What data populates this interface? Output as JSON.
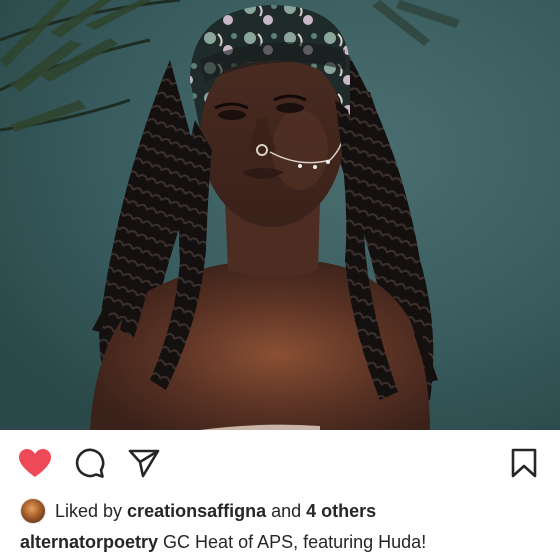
{
  "post": {
    "image_alt": "Portrait of a woman with long braids, patterned head wrap and nose chain against a teal wall"
  },
  "actions": {
    "like_color": "#ed4956",
    "icons": [
      "heart-icon",
      "comment-icon",
      "share-icon",
      "bookmark-icon"
    ]
  },
  "likes": {
    "prefix": "Liked by ",
    "user": "creationsaffigna",
    "connector": " and ",
    "others": "4 others"
  },
  "caption": {
    "username": "alternatorpoetry",
    "text": " GC Heat of APS, featuring Huda!"
  }
}
